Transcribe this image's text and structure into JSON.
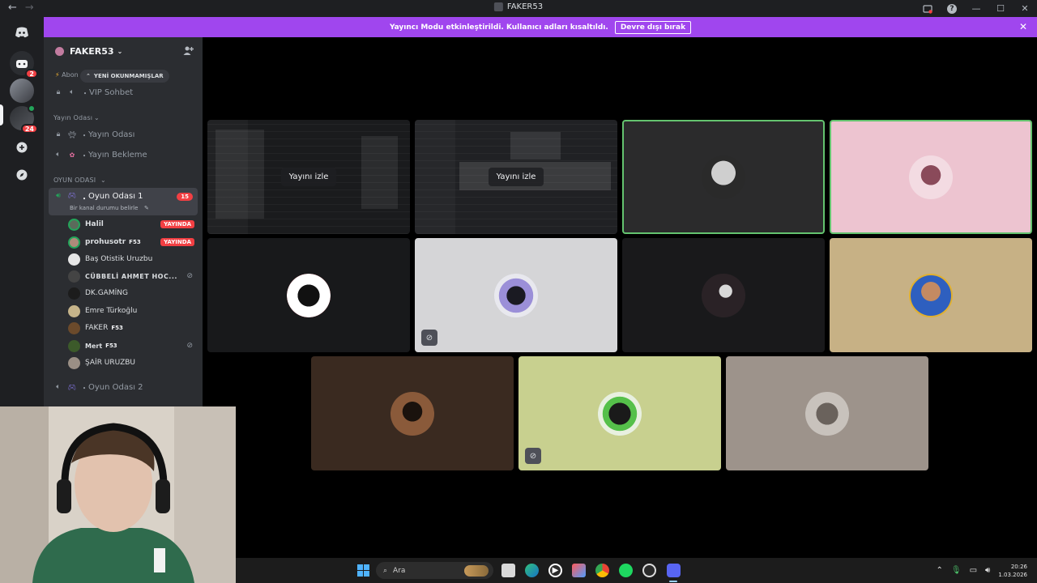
{
  "window": {
    "title": "FAKER53",
    "nav_back": "←",
    "nav_forward": "→",
    "help": "?",
    "minimize": "—",
    "maximize": "☐",
    "close": "✕"
  },
  "banner": {
    "text": "Yayıncı Modu etkinleştirildi. Kullanıcı adları kısaltıldı.",
    "button": "Devre dışı bırak",
    "close": "✕"
  },
  "rail": {
    "badges": [
      "2",
      "24"
    ]
  },
  "sidebar": {
    "server_name": "FAKER53",
    "server_chevron": "⌄",
    "abon_label": "Abon",
    "unread_pill": "YENİ OKUNMAMIŞLAR",
    "channels": [
      {
        "name": "VIP Sohbet"
      },
      {
        "name": "Yayın Odası"
      },
      {
        "name": "Yayın Bekleme"
      }
    ],
    "categories": [
      "Yayın Odası",
      "OYUN ODASI"
    ],
    "active_channel": {
      "name": "Oyun Odası 1",
      "count": "15",
      "status": "Bir kanal durumu belirle"
    },
    "members": [
      {
        "name": "Halil",
        "tag": "",
        "live": "YAYINDA"
      },
      {
        "name": "prohusotr",
        "tag": "F53",
        "live": "YAYINDA"
      },
      {
        "name": "Baş Otistik Uruzbu",
        "tag": "",
        "live": ""
      },
      {
        "name": "CÜBBELİ AHMET HOC...",
        "tag": "",
        "live": ""
      },
      {
        "name": "DK.GAMİNG",
        "tag": "",
        "live": ""
      },
      {
        "name": "Emre Türkoğlu",
        "tag": "",
        "live": ""
      },
      {
        "name": "FAKER",
        "tag": "F53",
        "live": ""
      },
      {
        "name": "Mert",
        "tag": "F53",
        "live": ""
      },
      {
        "name": "ŞAİR URUZBU",
        "tag": "",
        "live": ""
      }
    ],
    "next_channel": "Oyun Odası 2"
  },
  "stage": {
    "watch_label": "Yayını izle"
  },
  "taskbar": {
    "search_placeholder": "Ara",
    "time": "20:26",
    "date": "1.03.2026"
  },
  "colors": {
    "banner": "#a046ee",
    "sidebar": "#2b2d31",
    "rail": "#1e1f22",
    "live_red": "#f23f43",
    "speaking_green": "#23a55a"
  }
}
